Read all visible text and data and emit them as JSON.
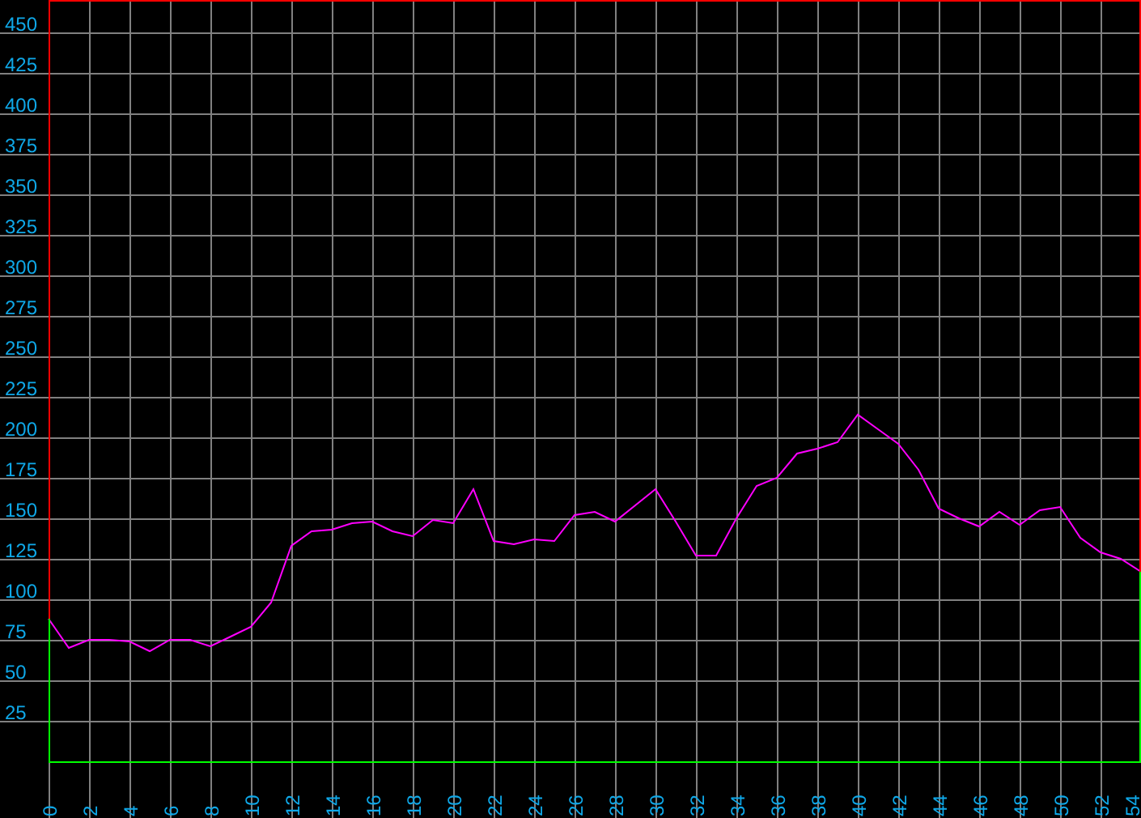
{
  "chart_data": {
    "type": "line",
    "x": [
      0,
      1,
      2,
      3,
      4,
      5,
      6,
      7,
      8,
      9,
      10,
      11,
      12,
      13,
      14,
      15,
      16,
      17,
      18,
      19,
      20,
      21,
      22,
      23,
      24,
      25,
      26,
      27,
      28,
      29,
      30,
      31,
      32,
      33,
      34,
      35,
      36,
      37,
      38,
      39,
      40,
      41,
      42,
      43,
      44,
      45,
      46,
      47,
      48,
      49,
      50,
      51,
      52,
      53,
      54
    ],
    "series": [
      {
        "color": "#ff00ff",
        "values": [
          88,
          70,
          75,
          75,
          74,
          68,
          75,
          75,
          71,
          77,
          83,
          98,
          133,
          142,
          143,
          147,
          148,
          142,
          139,
          149,
          147,
          168,
          136,
          134,
          137,
          136,
          152,
          154,
          148,
          158,
          168,
          148,
          127,
          127,
          150,
          170,
          175,
          190,
          193,
          197,
          214,
          205,
          196,
          180,
          156,
          150,
          145,
          154,
          146,
          155,
          157,
          138,
          129,
          125,
          117
        ]
      }
    ],
    "grid": true,
    "xlim": [
      0,
      54
    ],
    "ylim": [
      0,
      470
    ],
    "xticks": [
      0,
      2,
      4,
      6,
      8,
      10,
      12,
      14,
      16,
      18,
      20,
      22,
      24,
      26,
      28,
      30,
      32,
      34,
      36,
      38,
      40,
      42,
      44,
      46,
      48,
      50,
      52,
      54
    ],
    "yticks": [
      25,
      50,
      75,
      100,
      125,
      150,
      175,
      200,
      225,
      250,
      275,
      300,
      325,
      350,
      375,
      400,
      425,
      450
    ]
  }
}
